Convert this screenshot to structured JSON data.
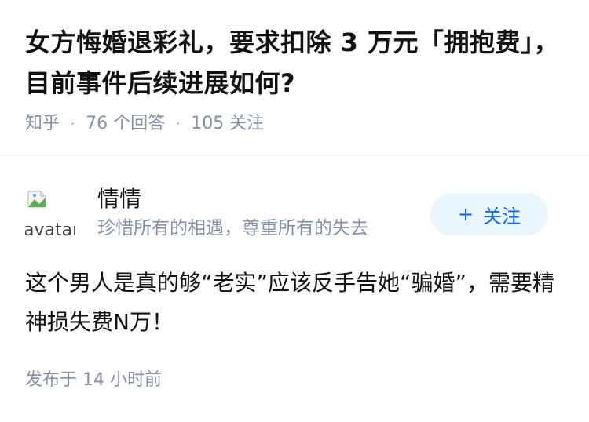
{
  "question": {
    "title": "女方悔婚退彩礼，要求扣除 3 万元「拥抱费」，目前事件后续进展如何?",
    "source": "知乎",
    "answer_count": "76 个回答",
    "follower_count": "105 关注",
    "separator": "·"
  },
  "author": {
    "name": "情情",
    "bio": "珍惜所有的相遇，尊重所有的失去",
    "avatar_alt": "avatar",
    "follow_label": "关注",
    "follow_icon": "+"
  },
  "answer": {
    "content": "这个男人是真的够“老实”应该反手告她“骗婚”，需要精神损失费N万！",
    "published": "发布于  14 小时前"
  }
}
